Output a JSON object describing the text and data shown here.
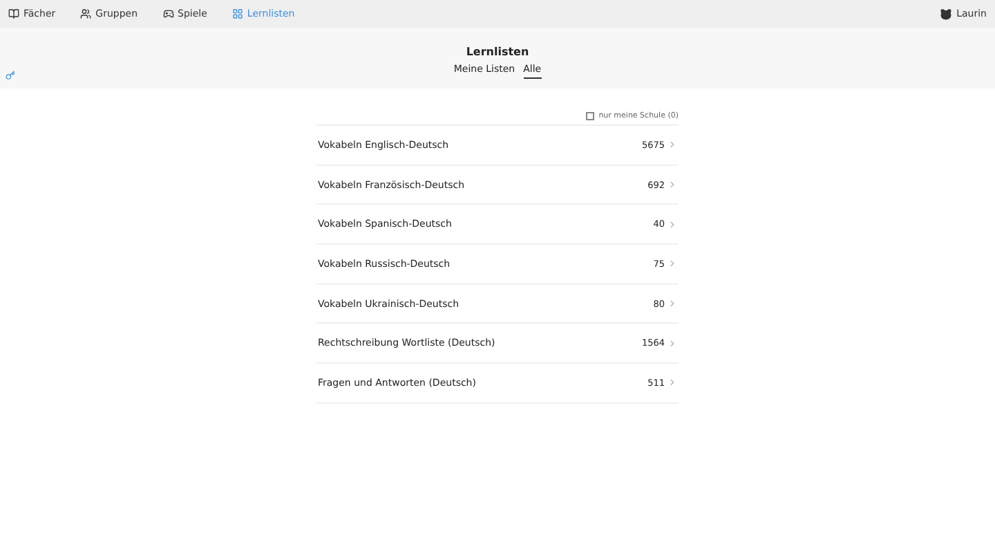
{
  "nav": {
    "items": [
      {
        "label": "Fächer",
        "selected": false
      },
      {
        "label": "Gruppen",
        "selected": false
      },
      {
        "label": "Spiele",
        "selected": false
      },
      {
        "label": "Lernlisten",
        "selected": true
      }
    ],
    "user": "Laurin"
  },
  "header": {
    "title": "Lernlisten",
    "tabs": [
      {
        "label": "Meine Listen",
        "selected": false
      },
      {
        "label": "Alle",
        "selected": true
      }
    ]
  },
  "filter": {
    "label": "nur meine Schule (0)",
    "checked": false
  },
  "lists": [
    {
      "name": "Vokabeln Englisch-Deutsch",
      "count": "5675"
    },
    {
      "name": "Vokabeln Französisch-Deutsch",
      "count": "692"
    },
    {
      "name": "Vokabeln Spanisch-Deutsch",
      "count": "40"
    },
    {
      "name": "Vokabeln Russisch-Deutsch",
      "count": "75"
    },
    {
      "name": "Vokabeln Ukrainisch-Deutsch",
      "count": "80"
    },
    {
      "name": "Rechtschreibung Wortliste (Deutsch)",
      "count": "1564"
    },
    {
      "name": "Fragen und Antworten (Deutsch)",
      "count": "511"
    }
  ]
}
